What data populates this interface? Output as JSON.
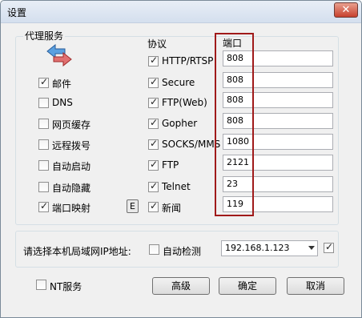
{
  "window": {
    "title": "设置",
    "close_icon": "close-icon"
  },
  "proxy_group": {
    "label": "代理服务",
    "icon": "swap-arrows-icon",
    "left_items": [
      {
        "label": "邮件",
        "checked": true
      },
      {
        "label": "DNS",
        "checked": false
      },
      {
        "label": "网页缓存",
        "checked": false
      },
      {
        "label": "远程拨号",
        "checked": false
      },
      {
        "label": "自动启动",
        "checked": false
      },
      {
        "label": "自动隐藏",
        "checked": false
      },
      {
        "label": "端口映射",
        "checked": true
      }
    ],
    "e_button": "E",
    "protocol_header": "协议",
    "port_header": "端口",
    "protocols": [
      {
        "label": "HTTP/RTSP",
        "checked": true,
        "port": "808"
      },
      {
        "label": "Secure",
        "checked": true,
        "port": "808"
      },
      {
        "label": "FTP(Web)",
        "checked": true,
        "port": "808"
      },
      {
        "label": "Gopher",
        "checked": true,
        "port": "808"
      },
      {
        "label": "SOCKS/MMS",
        "checked": true,
        "port": "1080"
      },
      {
        "label": "FTP",
        "checked": true,
        "port": "2121"
      },
      {
        "label": "Telnet",
        "checked": true,
        "port": "23"
      },
      {
        "label": "新闻",
        "checked": true,
        "port": "119"
      }
    ]
  },
  "lan": {
    "label": "请选择本机局域网IP地址:",
    "auto_detect_label": "自动检测",
    "auto_detect_checked": false,
    "ip": "192.168.1.123",
    "extra_checked": true
  },
  "footer": {
    "nt_service_label": "NT服务",
    "nt_service_checked": false,
    "advanced": "高级",
    "ok": "确定",
    "cancel": "取消"
  },
  "colors": {
    "highlight": "#a01a1a"
  }
}
